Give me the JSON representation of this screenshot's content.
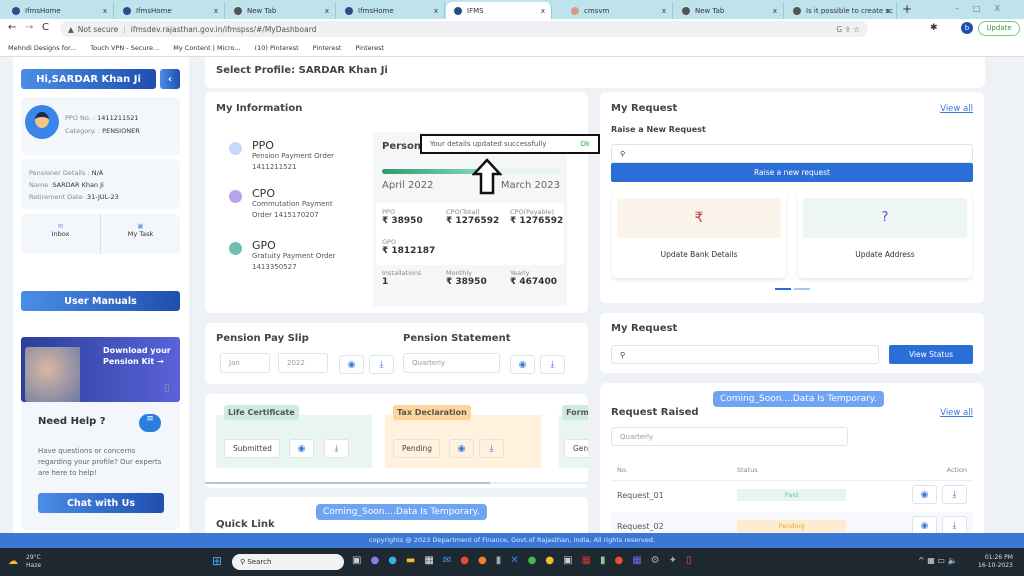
{
  "browser": {
    "tabs": [
      {
        "label": "IfmsHome"
      },
      {
        "label": "IfmsHome"
      },
      {
        "label": "New Tab"
      },
      {
        "label": "IfmsHome"
      },
      {
        "label": "IFMS",
        "active": true
      },
      {
        "label": "cmsvm"
      },
      {
        "label": "New Tab"
      },
      {
        "label": "Is it possible to create sc"
      }
    ],
    "security": "Not secure",
    "url": "ifmsdev.rajasthan.gov.in/ifmspss/#/MyDashboard",
    "update_label": "Update",
    "profile_initial": "b",
    "bookmarks": [
      "Mehndi Designs for...",
      "Touch VPN - Secure...",
      "My Content | Micro...",
      "(10) Pinterest",
      "Pinterest",
      "Pinterest"
    ]
  },
  "sidebar": {
    "greeting": "Hi,SARDAR Khan Ji",
    "ppo_label": "PPO No. :",
    "ppo_value": "1411211521",
    "category_label": "Category. :",
    "category_value": "PENSIONER",
    "details_label": "Pensioner Details :",
    "details_value": "N/A",
    "name_label": "Name :",
    "name_value": "SARDAR Khan Ji",
    "retire_label": "Retirement Date :",
    "retire_value": "31-JUL-23",
    "inbox": "Inbox",
    "mytask": "My Task",
    "manuals": "User Manuals",
    "kit": "Download your Pension Kit →",
    "help_title": "Need Help ?",
    "help_text": "Have questions or concerns regarding your profile? Our experts are here to help!",
    "chat": "Chat with Us"
  },
  "profile": {
    "title": "Select Profile: SARDAR Khan Ji"
  },
  "info": {
    "title": "My Information",
    "orders": [
      {
        "code": "PPO",
        "name": "Pension Payment Order",
        "num": "1411211521",
        "color": "#c4dafc"
      },
      {
        "code": "CPO",
        "name": "Commutation Payment Order 1415170207",
        "num": "",
        "color": "#b9a3e8"
      },
      {
        "code": "GPO",
        "name": "Gratuity Payment Order",
        "num": "1413350527",
        "color": "#6dbfb0"
      }
    ],
    "personal_title": "Persona",
    "progress": 0.55,
    "from": "April 2022",
    "to": "March 2023",
    "ppo_l": "PPO",
    "ppo_v": "₹ 38950",
    "cpot_l": "CPO(Total)",
    "cpot_v": "₹ 1276592",
    "cpop_l": "CPO(Payable)",
    "cpop_v": "₹ 1276592",
    "gpo_l": "GPO",
    "gpo_v": "₹ 1812187",
    "inst_l": "Installations",
    "inst_v": "1",
    "mon_l": "Monthly",
    "mon_v": "₹ 38950",
    "yr_l": "Yearly",
    "yr_v": "₹ 467400"
  },
  "toast": {
    "message": "Your details updated successfully",
    "ok": "Ok"
  },
  "payslip": {
    "title": "Pension Pay Slip",
    "month": "Jan",
    "year": "2022",
    "stmt_title": "Pension Statement",
    "stmt_placeholder": "Quarterly"
  },
  "certs": [
    {
      "title": "Life Certificate",
      "status": "Submitted"
    },
    {
      "title": "Tax Declaration",
      "status": "Pending"
    },
    {
      "title": "Form",
      "status": "Gene"
    }
  ],
  "quick": {
    "title": "Quick Link",
    "coming": "Coming_Soon....Data Is Temporary."
  },
  "request": {
    "title": "My Request",
    "view_all": "View all",
    "sub": "Raise a New Request",
    "raise_btn": "Raise a new request",
    "cards": [
      "Update Bank Details",
      "Update Address"
    ]
  },
  "request2": {
    "title": "My Request",
    "btn": "View Status"
  },
  "raised": {
    "coming": "Coming_Soon....Data Is Temporary.",
    "title": "Request Raised",
    "view_all": "View all",
    "placeholder": "Quarterly",
    "cols": [
      "No.",
      "Status",
      "Action"
    ],
    "rows": [
      {
        "no": "Request_01",
        "status": "Paid"
      },
      {
        "no": "Request_02",
        "status": "Pending"
      }
    ]
  },
  "footer": "copyrights @ 2023 Department of Finance, Govt.of Rajasthan, India, All rights reserved.",
  "taskbar": {
    "temp": "29°C",
    "weather": "Haze",
    "search": "Search",
    "time": "01:26 PM",
    "date": "16-10-2023"
  }
}
